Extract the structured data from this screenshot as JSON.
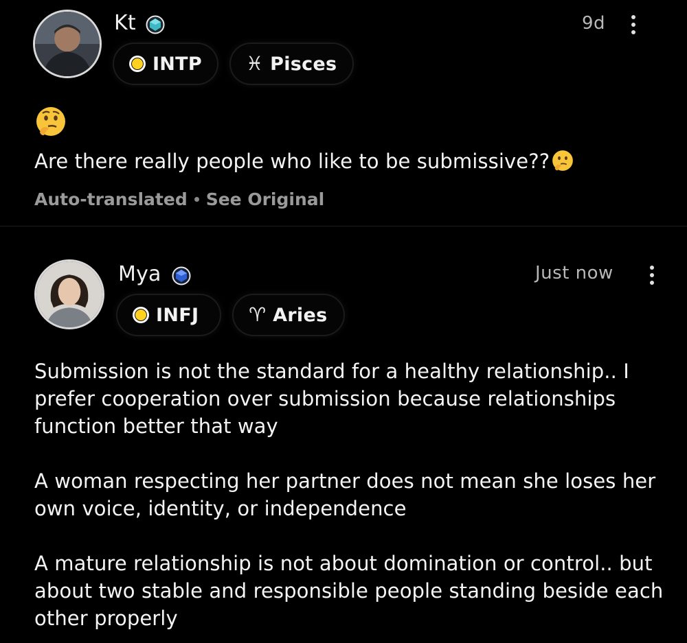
{
  "posts": [
    {
      "username": "Kt",
      "time": "9d",
      "mbti": "INTP",
      "zodiac": {
        "symbol": "♓",
        "name": "Pisces"
      },
      "emoji_line": "thinking-face-emoji",
      "text": "Are there really people who like to be submissive??",
      "meta": {
        "status": "Auto-translated",
        "action": "See Original"
      }
    },
    {
      "username": "Mya",
      "time": "Just now",
      "mbti": "INFJ",
      "zodiac": {
        "symbol": "♈",
        "name": "Aries"
      },
      "paragraphs": [
        "Submission is not the standard for a healthy relationship.. I prefer cooperation over submission because relationships function better that way",
        "A woman respecting her partner does not mean she loses her own voice, identity, or independence",
        "A mature relationship is not about domination or control.. but about two stable and responsible people standing beside each other properly"
      ]
    }
  ],
  "colors": {
    "background": "#000000",
    "mbti_dot": "#ffd21f",
    "gem_teal": "#3fb8c6",
    "gem_blue": "#2f5fd0"
  }
}
